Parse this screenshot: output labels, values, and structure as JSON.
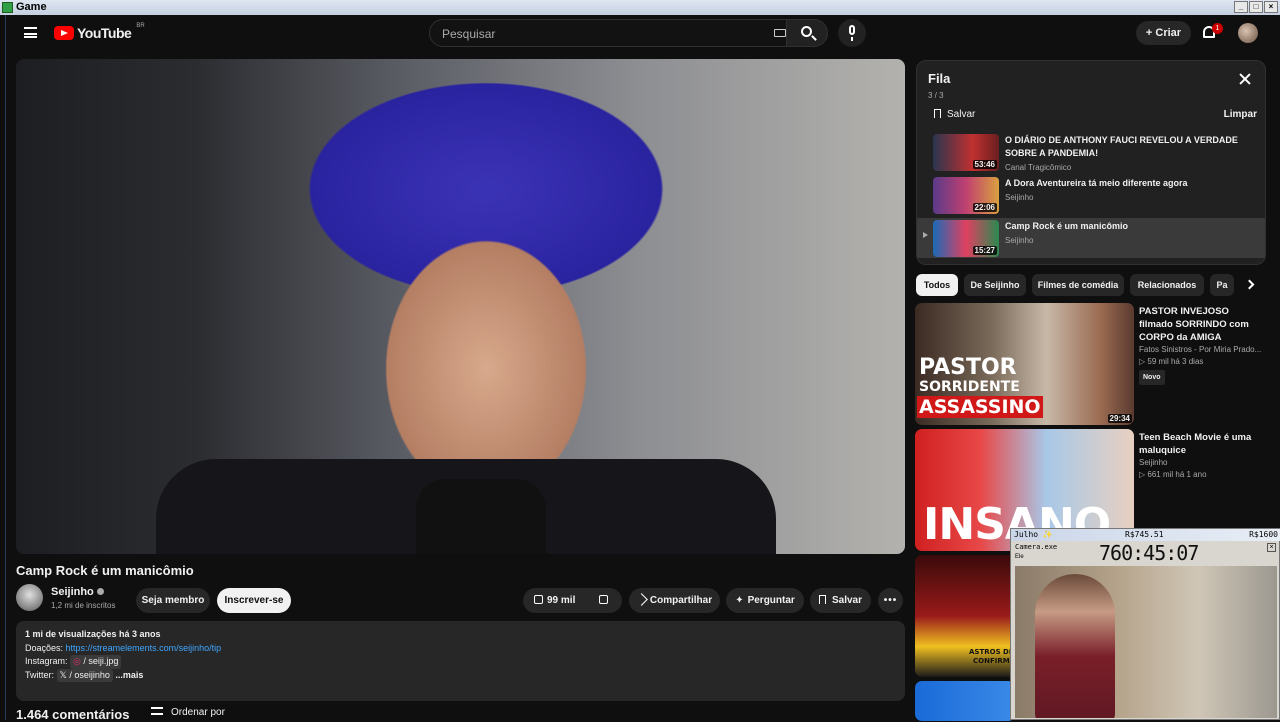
{
  "window": {
    "title": "Game"
  },
  "masthead": {
    "logo_text": "YouTube",
    "region": "BR",
    "search_placeholder": "Pesquisar",
    "create_label": "+ Criar",
    "notif_count": "1"
  },
  "video": {
    "title": "Camp Rock é um manicômio",
    "channel": "Seijinho",
    "subscribers": "1,2 mi de inscritos",
    "member_label": "Seja membro",
    "subscribe_label": "Inscrever-se",
    "likes": "99 mil",
    "share_label": "Compartilhar",
    "ask_label": "Perguntar",
    "save_label": "Salvar"
  },
  "description": {
    "meta": "1 mi de visualizações  há 3 anos",
    "donations_label": "Doações:",
    "donations_link": "https://streamelements.com/seijinho/tip",
    "instagram_label": "Instagram:",
    "instagram_value": "/ seiji.jpg",
    "twitter_label": "Twitter:",
    "twitter_value": "/ oseijinho",
    "more": "...mais"
  },
  "comments": {
    "count": "1.464 comentários",
    "sort_label": "Ordenar por"
  },
  "queue": {
    "title": "Fila",
    "position": "3 / 3",
    "save_label": "Salvar",
    "clear_label": "Limpar",
    "items": [
      {
        "title": "O DIÁRIO DE ANTHONY FAUCI REVELOU A VERDADE SOBRE A PANDEMIA!",
        "channel": "Canal Tragicômico",
        "duration": "53:46"
      },
      {
        "title": "A Dora Aventureira tá meio diferente agora",
        "channel": "Seijinho",
        "duration": "22:06"
      },
      {
        "title": "Camp Rock é um manicômio",
        "channel": "Seijinho",
        "duration": "15:27"
      }
    ]
  },
  "chips": [
    "Todos",
    "De Seijinho",
    "Filmes de comédia",
    "Relacionados",
    "Pa"
  ],
  "recommendations": [
    {
      "title": "PASTOR INVEJOSO filmado SORRINDO com CORPO da AMIGA",
      "channel": "Fatos Sinistros - Por Miria Prado...",
      "stats": "▷ 59 mil  há 3 dias",
      "badge": "Novo",
      "duration": "29:34",
      "thumb_text_1": "PASTOR",
      "thumb_text_2": "SORRIDENTE",
      "thumb_text_3": "ASSASSINO"
    },
    {
      "title": "Teen Beach Movie é uma maluquice",
      "channel": "Seijinho",
      "stats": "▷ 661 mil  há 1 ano",
      "thumb_text_1": "INSANO"
    },
    {
      "thumb_text_1": "ASTROS DE",
      "thumb_text_2": "CONFIRMA"
    }
  ],
  "overlay": {
    "label": "Julho ✨",
    "price_1": "R$745.51",
    "price_2": "R$1600",
    "camera": "Camera.exe",
    "timer": "760:45:07",
    "small": "Ele"
  },
  "colors": {
    "accent_red": "#ff0000",
    "link_blue": "#3ea6ff",
    "bg": "#0f0f0f"
  }
}
